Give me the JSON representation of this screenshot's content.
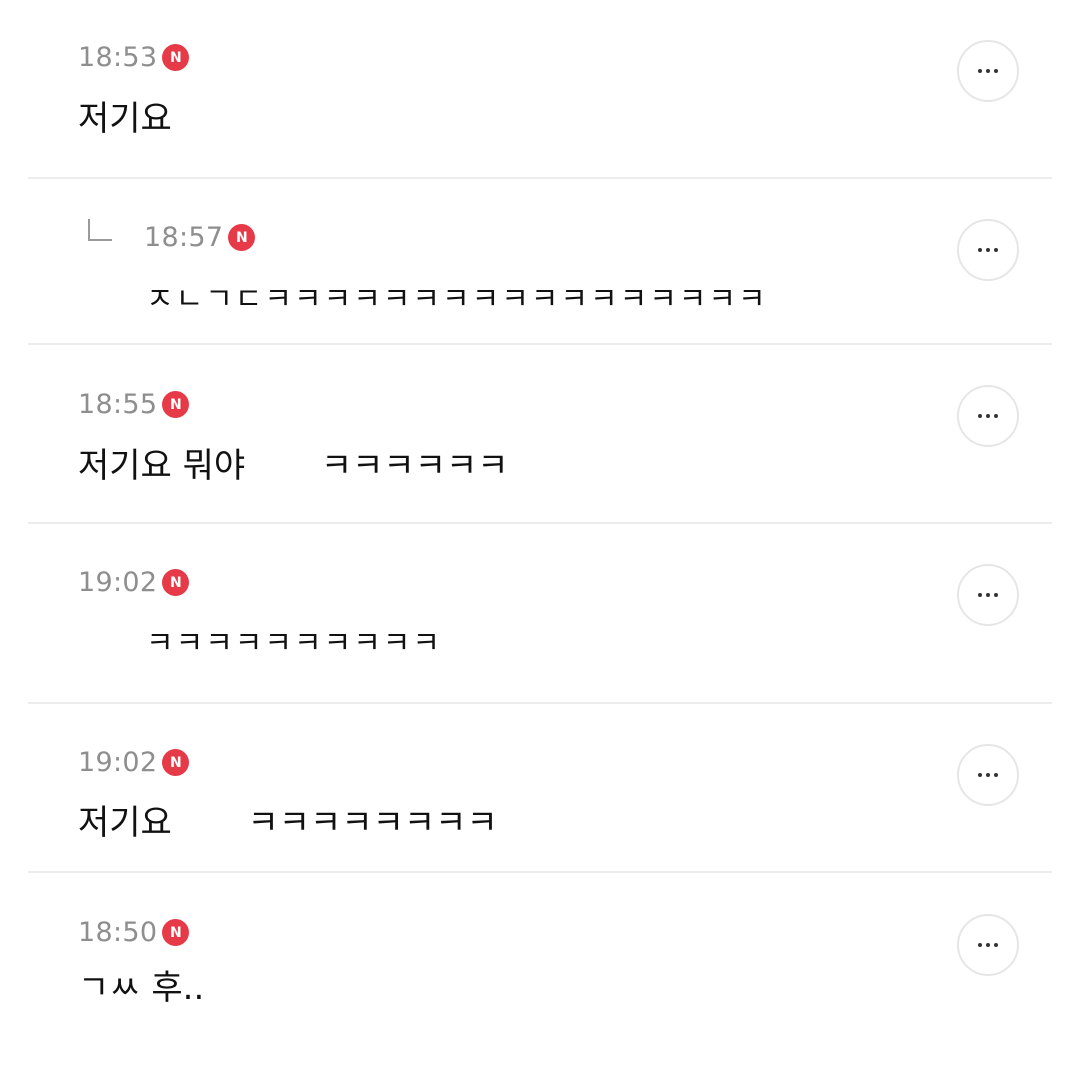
{
  "comments": [
    {
      "time": "18:53",
      "badge": "N",
      "text": "저기요"
    },
    {
      "time": "18:57",
      "badge": "N",
      "text": "ㅈㄴㄱㄷㅋㅋㅋㅋㅋㅋㅋㅋㅋㅋㅋㅋㅋㅋㅋㅋㅋ",
      "is_reply": true
    },
    {
      "time": "18:55",
      "badge": "N",
      "text": "저기요 뭐야       ㅋㅋㅋㅋㅋㅋ"
    },
    {
      "time": "19:02",
      "badge": "N",
      "text": "ㅋㅋㅋㅋㅋㅋㅋㅋㅋㅋ"
    },
    {
      "time": "19:02",
      "badge": "N",
      "text": "저기요       ㅋㅋㅋㅋㅋㅋㅋㅋ"
    },
    {
      "time": "18:50",
      "badge": "N",
      "text": "ㄱㅆ 후.."
    }
  ],
  "colors": {
    "badge": "#e63a48",
    "time": "#8e8e8e",
    "text": "#111111",
    "divider": "#ececec"
  },
  "icons": {
    "new_badge": "n-badge-icon",
    "more": "more-horizontal-icon",
    "reply": "reply-arrow-icon"
  }
}
